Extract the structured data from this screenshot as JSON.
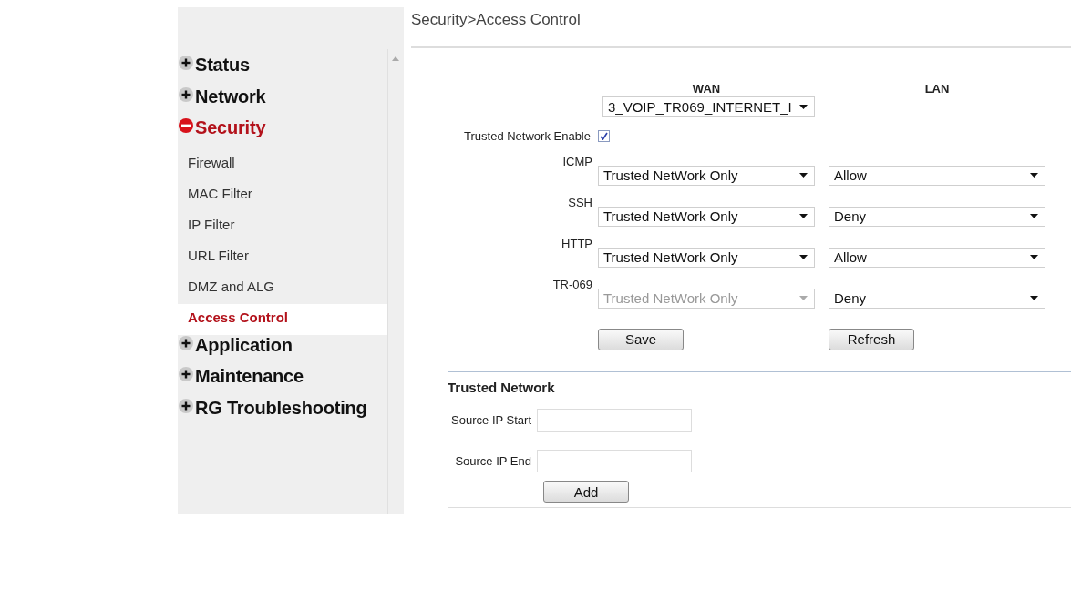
{
  "sidebar": {
    "menu": [
      {
        "label": "Status",
        "expanded": false
      },
      {
        "label": "Network",
        "expanded": false
      },
      {
        "label": "Security",
        "expanded": true,
        "children": [
          {
            "label": "Firewall",
            "selected": false
          },
          {
            "label": "MAC Filter",
            "selected": false
          },
          {
            "label": "IP Filter",
            "selected": false
          },
          {
            "label": "URL Filter",
            "selected": false
          },
          {
            "label": "DMZ and ALG",
            "selected": false
          },
          {
            "label": "Access Control",
            "selected": true
          }
        ]
      },
      {
        "label": "Application",
        "expanded": false
      },
      {
        "label": "Maintenance",
        "expanded": false
      },
      {
        "label": "RG Troubleshooting",
        "expanded": false
      }
    ]
  },
  "breadcrumb": "Security>Access Control",
  "access_control": {
    "columns": [
      "WAN",
      "LAN"
    ],
    "wan_connection": "3_VOIP_TR069_INTERNET_I",
    "trusted_network_enable": {
      "label": "Trusted Network Enable",
      "checked": true
    },
    "rules": [
      {
        "protocol": "ICMP",
        "wan": {
          "value": "Trusted NetWork Only",
          "disabled": false
        },
        "lan": {
          "value": "Allow",
          "disabled": false
        }
      },
      {
        "protocol": "SSH",
        "wan": {
          "value": "Trusted NetWork Only",
          "disabled": false
        },
        "lan": {
          "value": "Deny",
          "disabled": false
        }
      },
      {
        "protocol": "HTTP",
        "wan": {
          "value": "Trusted NetWork Only",
          "disabled": false
        },
        "lan": {
          "value": "Allow",
          "disabled": false
        }
      },
      {
        "protocol": "TR-069",
        "wan": {
          "value": "Trusted NetWork Only",
          "disabled": true
        },
        "lan": {
          "value": "Deny",
          "disabled": false
        }
      }
    ],
    "buttons": [
      "Save",
      "Refresh"
    ]
  },
  "trusted_network": {
    "title": "Trusted Network",
    "fields": [
      {
        "label": "Source IP Start"
      },
      {
        "label": "Source IP End"
      }
    ],
    "button": "Add"
  }
}
